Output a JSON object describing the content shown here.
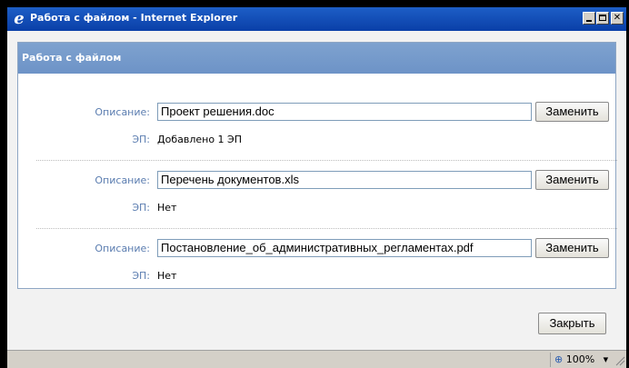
{
  "window": {
    "title": "Работа с файлом - Internet Explorer"
  },
  "panel": {
    "title": "Работа с файлом"
  },
  "files": [
    {
      "description_label": "Описание:",
      "description_value": "Проект решения.doc",
      "replace_label": "Заменить",
      "ep_label": "ЭП:",
      "ep_value": "Добавлено 1 ЭП"
    },
    {
      "description_label": "Описание:",
      "description_value": "Перечень документов.xls",
      "replace_label": "Заменить",
      "ep_label": "ЭП:",
      "ep_value": "Нет"
    },
    {
      "description_label": "Описание:",
      "description_value": "Постановление_об_административных_регламентах.pdf",
      "replace_label": "Заменить",
      "ep_label": "ЭП:",
      "ep_value": "Нет"
    }
  ],
  "footer": {
    "close_label": "Закрыть"
  },
  "statusbar": {
    "zoom": "100%"
  },
  "icons": {
    "browser": "ie-icon",
    "zoom": "magnifier-icon",
    "resize": "resize-grip-icon"
  },
  "colors": {
    "titlebar": "#0A3FA8",
    "panel_header": "#7EA2CF",
    "label": "#5B7DB0"
  }
}
